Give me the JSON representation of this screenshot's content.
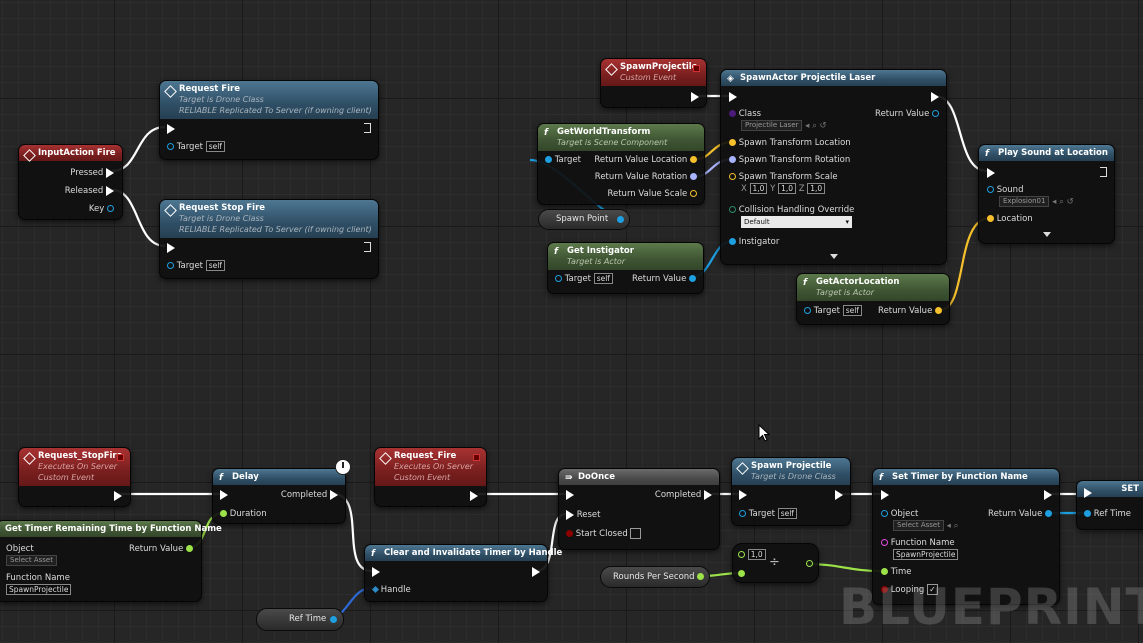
{
  "watermark": "BLUEPRINT",
  "colors": {
    "exec": "#ffffff",
    "object": "#1e9fe0",
    "vector": "#f5c02b",
    "rotator": "#a9b4ff",
    "bool": "#8b0000",
    "float": "#9ce34a",
    "class": "#7a1fc7",
    "string": "#e44ae4",
    "struct": "#2d8bc8"
  },
  "nodes": {
    "input_action_fire": {
      "title": "InputAction Fire",
      "pressed": "Pressed",
      "released": "Released",
      "key": "Key"
    },
    "request_fire": {
      "title": "Request Fire",
      "sub1": "Target is Drone Class",
      "sub2": "RELIABLE Replicated To Server (if owning client)",
      "target": "Target",
      "self": "self"
    },
    "request_stop_fire": {
      "title": "Request Stop Fire",
      "sub1": "Target is Drone Class",
      "sub2": "RELIABLE Replicated To Server (if owning client)",
      "target": "Target",
      "self": "self"
    },
    "spawn_projectile_event": {
      "title": "SpawnProjectile",
      "sub": "Custom Event"
    },
    "spawn_actor": {
      "title": "SpawnActor Projectile Laser",
      "class": "Class",
      "class_value": "Projectile Laser",
      "return_value": "Return Value",
      "loc": "Spawn Transform Location",
      "rot": "Spawn Transform Rotation",
      "scale": "Spawn Transform Scale",
      "x": "X",
      "y": "Y",
      "z": "Z",
      "sx": "1,0",
      "sy": "1,0",
      "sz": "1,0",
      "collision": "Collision Handling Override",
      "collision_value": "Default",
      "instigator": "Instigator"
    },
    "get_world_transform": {
      "title": "GetWorldTransform",
      "sub": "Target is Scene Component",
      "target": "Target",
      "rv_loc": "Return Value Location",
      "rv_rot": "Return Value Rotation",
      "rv_scale": "Return Value Scale"
    },
    "spawn_point": {
      "label": "Spawn Point"
    },
    "get_instigator": {
      "title": "Get Instigator",
      "sub": "Target is Actor",
      "target": "Target",
      "self": "self",
      "return_value": "Return Value"
    },
    "play_sound": {
      "title": "Play Sound at Location",
      "sound": "Sound",
      "sound_value": "Explosion01",
      "location": "Location"
    },
    "get_actor_location": {
      "title": "GetActorLocation",
      "sub": "Target is Actor",
      "target": "Target",
      "self": "self",
      "return_value": "Return Value"
    },
    "request_stopfire_event": {
      "title": "Request_StopFire",
      "sub1": "Executes On Server",
      "sub2": "Custom Event"
    },
    "delay": {
      "title": "Delay",
      "completed": "Completed",
      "duration": "Duration"
    },
    "request_fire_event": {
      "title": "Request_Fire",
      "sub1": "Executes On Server",
      "sub2": "Custom Event"
    },
    "do_once": {
      "title": "DoOnce",
      "completed": "Completed",
      "reset": "Reset",
      "start_closed": "Start Closed"
    },
    "spawn_projectile_call": {
      "title": "Spawn Projectile",
      "sub": "Target is Drone Class",
      "target": "Target",
      "self": "self"
    },
    "set_timer": {
      "title": "Set Timer by Function Name",
      "object": "Object",
      "object_value": "Select Asset",
      "return_value": "Return Value",
      "function_name": "Function Name",
      "function_value": "SpawnProjectile",
      "time": "Time",
      "looping": "Looping"
    },
    "set": {
      "title": "SET",
      "ref_time": "Ref Time"
    },
    "get_timer_remaining": {
      "title": "Get Timer Remaining Time by Function Name",
      "object": "Object",
      "object_value": "Select Asset",
      "return_value": "Return Value",
      "function_name": "Function Name",
      "function_value": "SpawnProjectile"
    },
    "clear_timer": {
      "title": "Clear and Invalidate Timer by Handle",
      "handle": "Handle"
    },
    "ref_time_get": {
      "label": "Ref Time"
    },
    "divide": {
      "value": "1,0",
      "symbol": "÷"
    },
    "rounds_per_second": {
      "label": "Rounds Per Second"
    }
  }
}
